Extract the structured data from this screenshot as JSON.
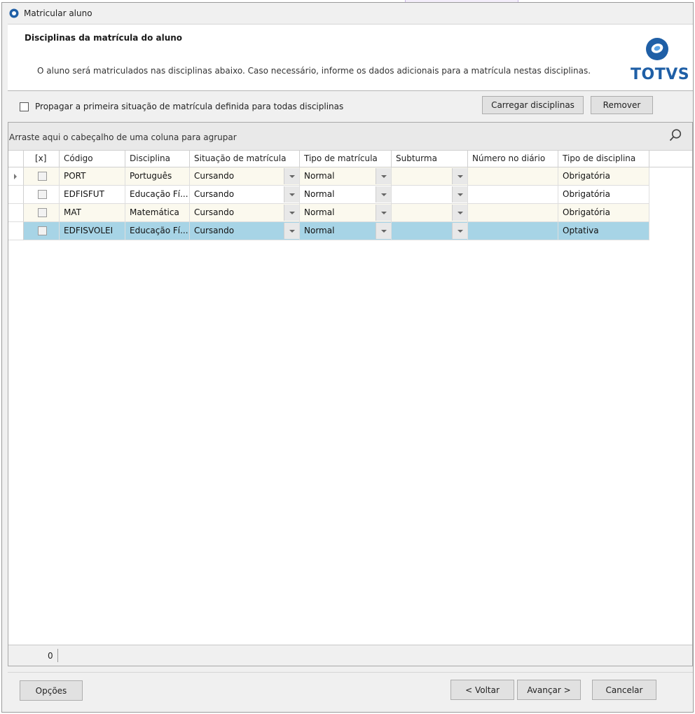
{
  "window": {
    "title": "Matricular aluno"
  },
  "header": {
    "title": "Disciplinas da matrícula do aluno",
    "description": "O aluno será matriculados nas disciplinas abaixo. Caso necessário, informe os dados adicionais para a matrícula nestas disciplinas.",
    "logo_text": "TOTVS"
  },
  "options": {
    "propagate_label": "Propagar a primeira situação de matrícula definida para todas disciplinas",
    "propagate_checked": false,
    "load_button": "Carregar disciplinas",
    "remove_button": "Remover"
  },
  "grid": {
    "group_hint": "Arraste aqui o cabeçalho de uma coluna para agrupar",
    "columns": [
      "[x]",
      "Código",
      "Disciplina",
      "Situação de matrícula",
      "Tipo de matrícula",
      "Subturma",
      "Número no diário",
      "Tipo de disciplina"
    ],
    "rows": [
      {
        "checked": false,
        "codigo": "PORT",
        "disciplina": "Português",
        "situacao": "Cursando",
        "tipo_matricula": "Normal",
        "subturma": "",
        "numero_diario": "",
        "tipo_disciplina": "Obrigatória",
        "selected": false,
        "current": true
      },
      {
        "checked": false,
        "codigo": "EDFISFUT",
        "disciplina": "Educação Fí...",
        "situacao": "Cursando",
        "tipo_matricula": "Normal",
        "subturma": "",
        "numero_diario": "",
        "tipo_disciplina": "Obrigatória",
        "selected": false,
        "current": false
      },
      {
        "checked": false,
        "codigo": "MAT",
        "disciplina": "Matemática",
        "situacao": "Cursando",
        "tipo_matricula": "Normal",
        "subturma": "",
        "numero_diario": "",
        "tipo_disciplina": "Obrigatória",
        "selected": false,
        "current": false
      },
      {
        "checked": false,
        "codigo": "EDFISVOLEI",
        "disciplina": "Educação Fí...",
        "situacao": "Cursando",
        "tipo_matricula": "Normal",
        "subturma": "",
        "numero_diario": "",
        "tipo_disciplina": "Optativa",
        "selected": true,
        "current": false
      }
    ],
    "footer_count": "0"
  },
  "buttons": {
    "options": "Opções",
    "back": "< Voltar",
    "next": "Avançar >",
    "cancel": "Cancelar"
  },
  "colors": {
    "accent": "#1f5fa6",
    "selected_row": "#a7d4e6",
    "alt_row": "#fbf9ee",
    "logo_blue": "#2e7bd1"
  }
}
